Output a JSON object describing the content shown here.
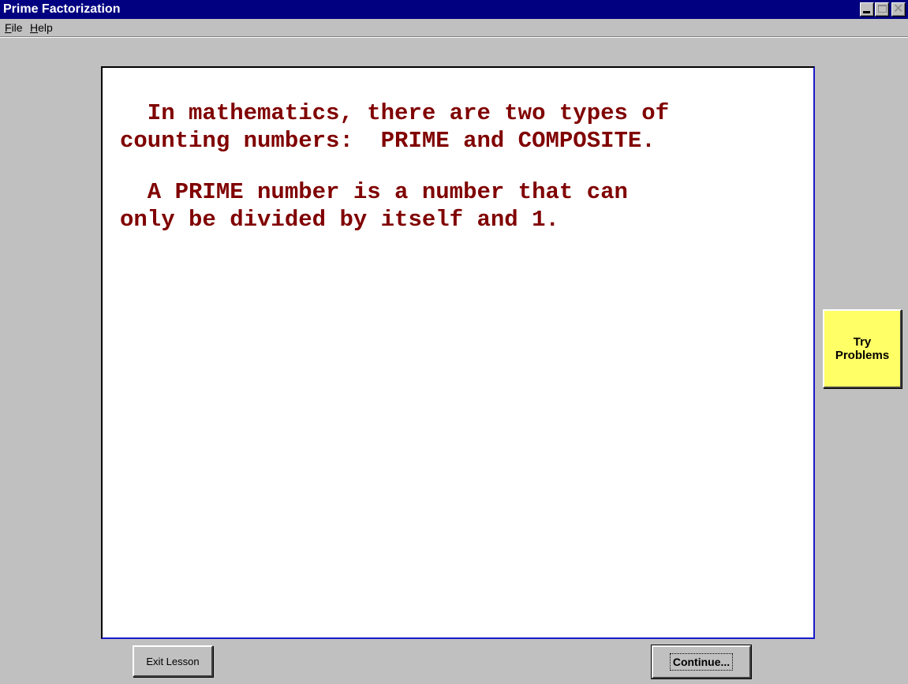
{
  "window": {
    "title": "Prime Factorization"
  },
  "menu": {
    "items": [
      {
        "label": "File"
      },
      {
        "label": "Help"
      }
    ]
  },
  "lesson": {
    "paragraphs": [
      "  In mathematics, there are two types of\ncounting numbers:  PRIME and COMPOSITE.",
      "  A PRIME number is a number that can\nonly be divided by itself and 1."
    ]
  },
  "buttons": {
    "try_problems": "Try\nProblems",
    "exit_lesson": "Exit Lesson",
    "continue": "Continue..."
  },
  "colors": {
    "title_bar": "#000080",
    "lesson_text": "#800000",
    "try_button": "#ffff66",
    "window_bg": "#c0c0c0"
  }
}
